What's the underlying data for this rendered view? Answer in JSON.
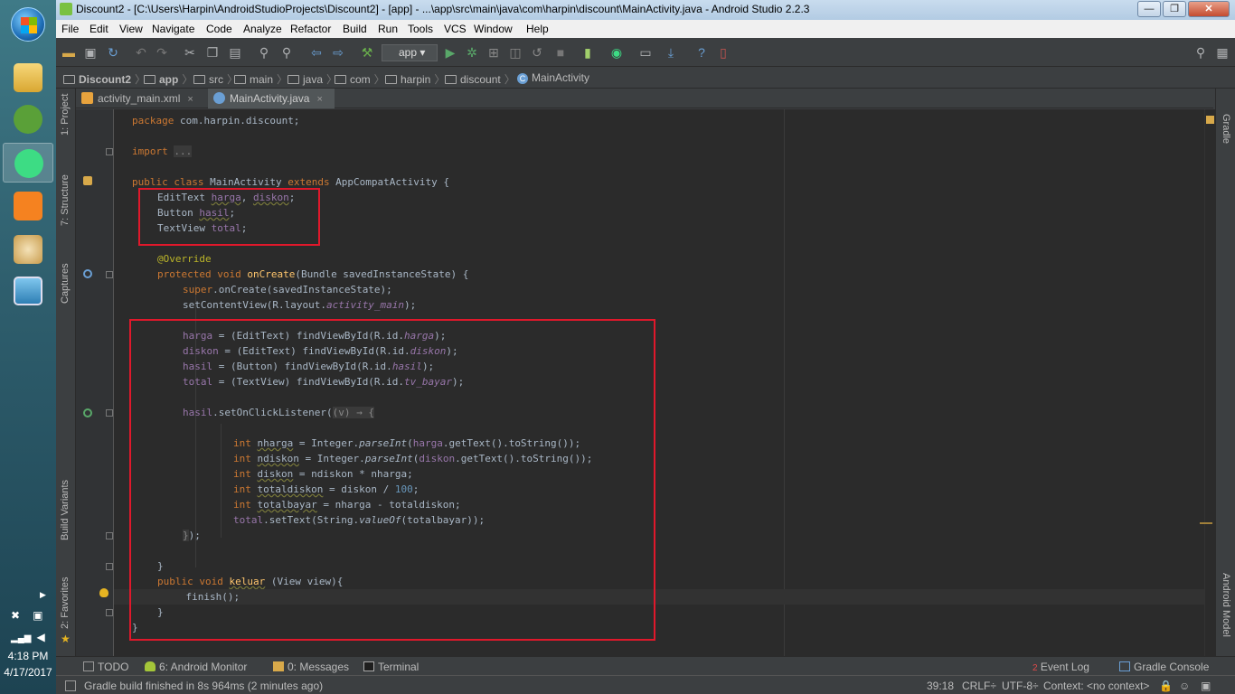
{
  "window": {
    "title": "Discount2 - [C:\\Users\\Harpin\\AndroidStudioProjects\\Discount2] - [app] - ...\\app\\src\\main\\java\\com\\harpin\\discount\\MainActivity.java - Android Studio 2.2.3",
    "minimize": "—",
    "maximize": "❐",
    "close": "✕"
  },
  "menu": [
    "File",
    "Edit",
    "View",
    "Navigate",
    "Code",
    "Analyze",
    "Refactor",
    "Build",
    "Run",
    "Tools",
    "VCS",
    "Window",
    "Help"
  ],
  "toolbar": {
    "run_config": "app"
  },
  "breadcrumbs": [
    "Discount2",
    "app",
    "src",
    "main",
    "java",
    "com",
    "harpin",
    "discount",
    "MainActivity"
  ],
  "tabs": [
    {
      "label": "activity_main.xml",
      "close": "×"
    },
    {
      "label": "MainActivity.java",
      "close": "×"
    }
  ],
  "left_tools": [
    "1: Project",
    "7: Structure",
    "Captures",
    "Build Variants",
    "2: Favorites"
  ],
  "right_tools": [
    "Gradle",
    "Android Model"
  ],
  "bottom_tools": [
    "TODO",
    "6: Android Monitor",
    "0: Messages",
    "Terminal"
  ],
  "bottom_right_tools": [
    "Event Log",
    "Gradle Console"
  ],
  "event_log_count": "2",
  "status": {
    "message": "Gradle build finished in 8s 964ms (2 minutes ago)",
    "position": "39:18",
    "line_sep": "CRLF÷",
    "encoding": "UTF-8÷",
    "context": "Context: <no context>"
  },
  "taskbar": {
    "time": "4:18 PM",
    "date": "4/17/2017"
  },
  "colors": {
    "highlight_box": "#e0182b",
    "editor_bg": "#2b2b2b",
    "keyword": "#cc7832"
  }
}
